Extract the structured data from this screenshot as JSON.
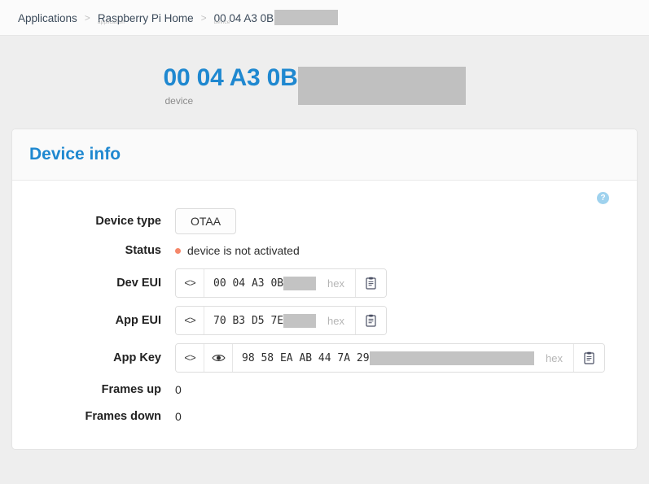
{
  "breadcrumb": {
    "items": [
      {
        "label": "Applications",
        "sub": "",
        "redacted": false
      },
      {
        "label": "Raspberry Pi Home",
        "sub": "application",
        "redacted": false
      },
      {
        "label": "00 04 A3 0B",
        "sub": "device",
        "redacted": true
      }
    ],
    "separator": ">"
  },
  "header": {
    "title": "00 04 A3 0B",
    "subtitle": "device",
    "redacted": true
  },
  "card": {
    "title": "Device info",
    "help_icon_label": "?"
  },
  "fields": {
    "device_type": {
      "label": "Device type",
      "value": "OTAA"
    },
    "status": {
      "label": "Status",
      "value": "device is not activated",
      "dot_color": "#f5876a"
    },
    "dev_eui": {
      "label": "Dev EUI",
      "value": "00 04 A3 0B",
      "hex_label": "hex",
      "code_icon": "<>",
      "copy_icon": "clipboard-icon",
      "redact_width": 95
    },
    "app_eui": {
      "label": "App EUI",
      "value": "70 B3 D5 7E",
      "hex_label": "hex",
      "code_icon": "<>",
      "copy_icon": "clipboard-icon",
      "redact_width": 95
    },
    "app_key": {
      "label": "App Key",
      "value": "98 58 EA AB 44 7A 29",
      "hex_label": "hex",
      "code_icon": "<>",
      "eye_icon": "eye-icon",
      "copy_icon": "clipboard-icon",
      "redact_width": 208
    },
    "frames_up": {
      "label": "Frames up",
      "value": "0"
    },
    "frames_down": {
      "label": "Frames down",
      "value": "0"
    }
  },
  "colors": {
    "accent": "#1f88d0",
    "page_bg": "#eeeeee",
    "status": "#f5876a",
    "redaction": "#c3c3c3"
  }
}
